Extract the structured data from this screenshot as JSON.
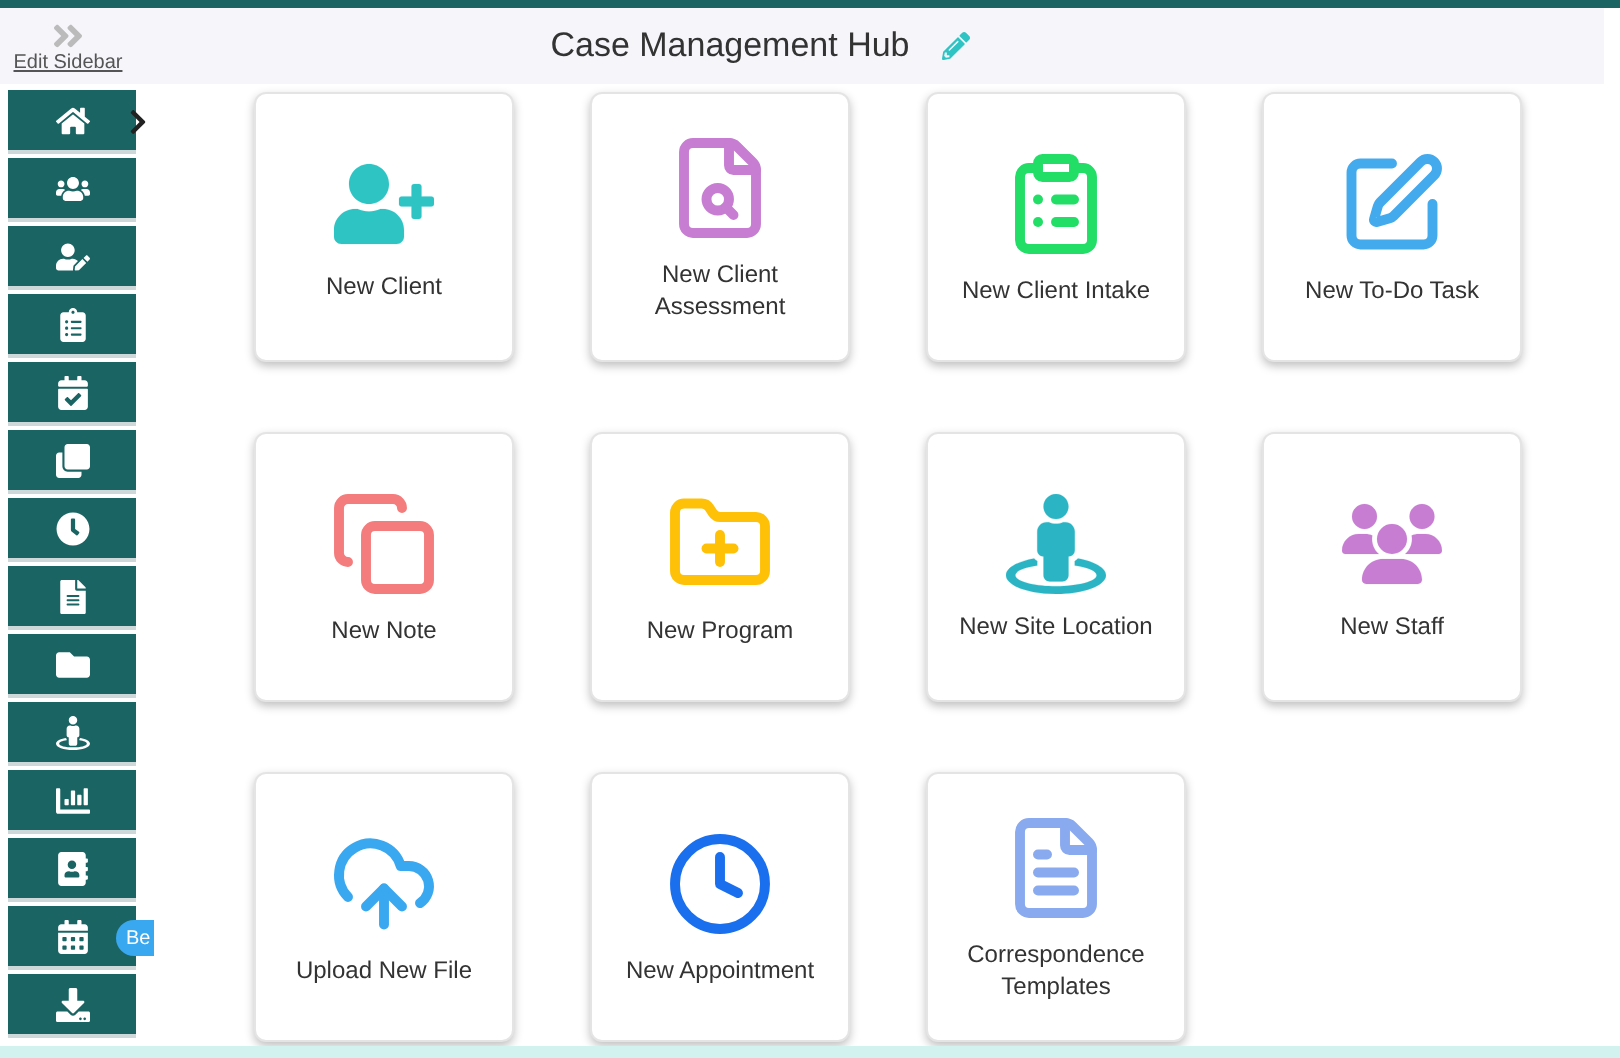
{
  "header": {
    "edit_sidebar": "Edit Sidebar",
    "title": "Case Management Hub"
  },
  "sidebar": {
    "items": [
      {
        "expander": true
      },
      {
        "expander": false
      },
      {
        "expander": false
      },
      {
        "expander": false
      },
      {
        "expander": false
      },
      {
        "expander": false
      },
      {
        "expander": false
      },
      {
        "expander": false
      },
      {
        "expander": false
      },
      {
        "expander": false
      },
      {
        "expander": false
      },
      {
        "expander": false
      },
      {
        "expander": false,
        "badge": "Be"
      },
      {
        "expander": false
      }
    ]
  },
  "cards": [
    {
      "label": "New Client",
      "color": "#2ec4c4"
    },
    {
      "label": "New Client Assessment",
      "color": "#c77dd1"
    },
    {
      "label": "New Client Intake",
      "color": "#22dd66"
    },
    {
      "label": "New To-Do Task",
      "color": "#44aaee"
    },
    {
      "label": "New Note",
      "color": "#f47c7c"
    },
    {
      "label": "New Program",
      "color": "#ffc107"
    },
    {
      "label": "New Site Location",
      "color": "#2bb5c4"
    },
    {
      "label": "New Staff",
      "color": "#c77dd1"
    },
    {
      "label": "Upload New File",
      "color": "#3aa8f0"
    },
    {
      "label": "New Appointment",
      "color": "#1a6fef"
    },
    {
      "label": "Correspondence Templates",
      "color": "#8aaaf0"
    }
  ]
}
